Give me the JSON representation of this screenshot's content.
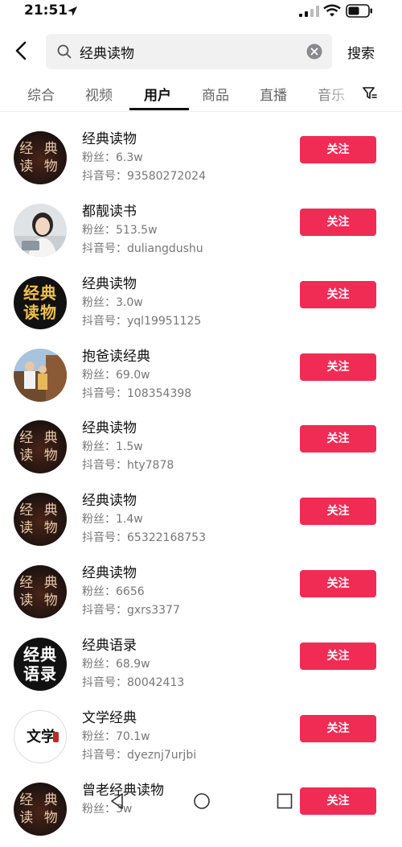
{
  "status_bar": {
    "time": "21:51"
  },
  "search": {
    "query": "经典读物",
    "submit_label": "搜索"
  },
  "tabs": [
    {
      "label": "综合"
    },
    {
      "label": "视频"
    },
    {
      "label": "用户",
      "active": true
    },
    {
      "label": "商品"
    },
    {
      "label": "直播"
    },
    {
      "label": "音乐"
    }
  ],
  "users": [
    {
      "name": "经典读物",
      "fans": "粉丝：6.3w",
      "douyin_id": "抖音号：93580272024",
      "avatar_text": [
        "经 典",
        "读 物"
      ],
      "follow_label": "关注"
    },
    {
      "name": "都靓读书",
      "fans": "粉丝：513.5w",
      "douyin_id": "抖音号：duliangdushu",
      "avatar_text": [],
      "follow_label": "关注"
    },
    {
      "name": "经典读物",
      "fans": "粉丝：3.0w",
      "douyin_id": "抖音号：yql19951125",
      "avatar_text": [
        "经典",
        "读物"
      ],
      "follow_label": "关注"
    },
    {
      "name": "抱爸读经典",
      "fans": "粉丝：69.0w",
      "douyin_id": "抖音号：108354398",
      "avatar_text": [],
      "follow_label": "关注"
    },
    {
      "name": "经典读物",
      "fans": "粉丝：1.5w",
      "douyin_id": "抖音号：hty7878",
      "avatar_text": [
        "经 典",
        "读 物"
      ],
      "follow_label": "关注"
    },
    {
      "name": "经典读物",
      "fans": "粉丝：1.4w",
      "douyin_id": "抖音号：65322168753",
      "avatar_text": [
        "经 典",
        "读 物"
      ],
      "follow_label": "关注"
    },
    {
      "name": "经典读物",
      "fans": "粉丝：6656",
      "douyin_id": "抖音号：gxrs3377",
      "avatar_text": [
        "经 典",
        "读 物"
      ],
      "follow_label": "关注"
    },
    {
      "name": "经典语录",
      "fans": "粉丝：68.9w",
      "douyin_id": "抖音号：80042413",
      "avatar_text": [
        "经典",
        "语录"
      ],
      "follow_label": "关注"
    },
    {
      "name": "文学经典",
      "fans": "粉丝：70.1w",
      "douyin_id": "抖音号：dyeznj7urjbi",
      "avatar_text": [
        "文学"
      ],
      "follow_label": "关注"
    },
    {
      "name": "曾老经典读物",
      "fans": "粉丝：3w",
      "douyin_id": "",
      "avatar_text": [
        "经 典",
        "读 物"
      ],
      "follow_label": "关注"
    }
  ],
  "colors": {
    "follow_button": "#f02c55",
    "active_tab": "#111111"
  }
}
